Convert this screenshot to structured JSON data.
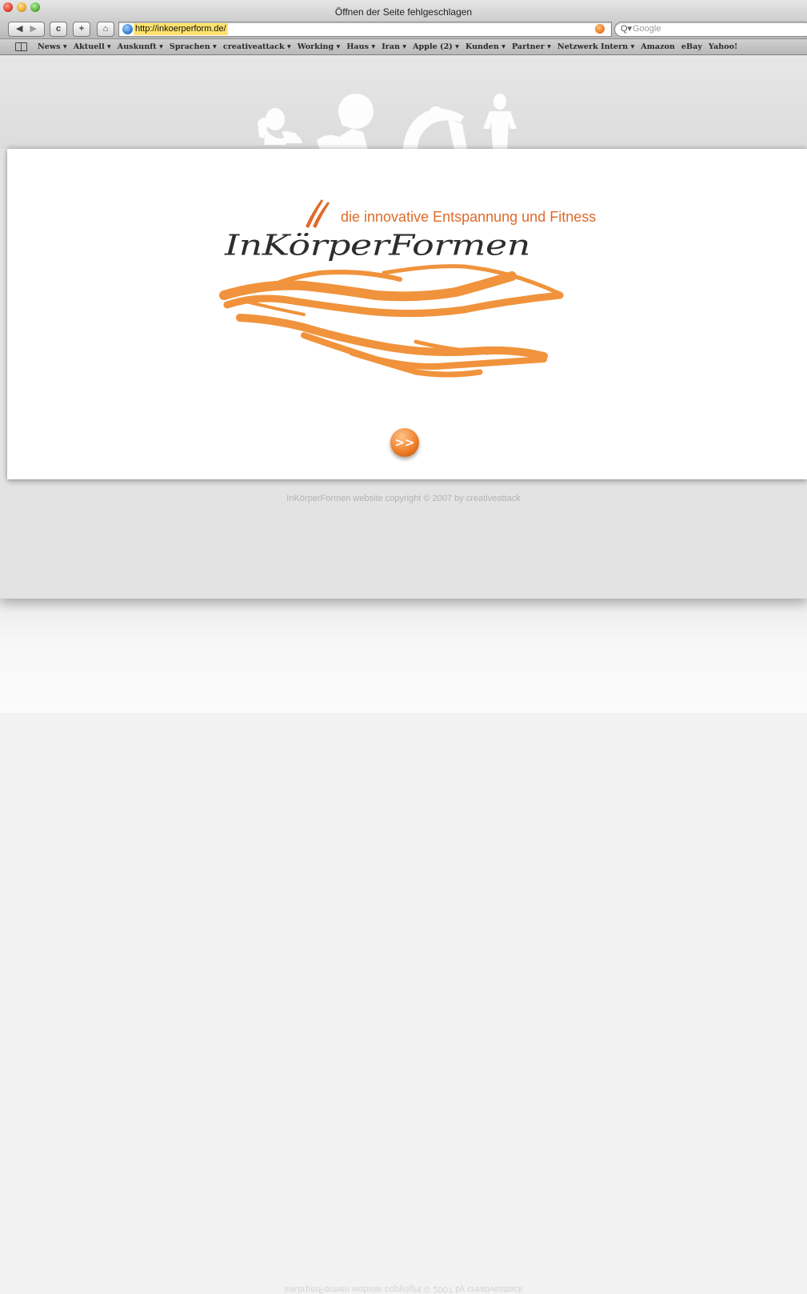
{
  "window": {
    "title": "Öffnen der Seite fehlgeschlagen"
  },
  "toolbar": {
    "back_icon": "back-arrow-icon",
    "forward_icon": "forward-arrow-icon",
    "reload_label": "c",
    "add_label": "+",
    "home_icon": "home-icon",
    "url": "http://inkoerperform.de/",
    "search_placeholder": "Google"
  },
  "bookmarks": [
    "News ▾",
    "Aktuell ▾",
    "Auskunft ▾",
    "Sprachen ▾",
    "creativeattack ▾",
    "Working ▾",
    "Haus ▾",
    "Iran ▾",
    "Apple (2) ▾",
    "Kunden ▾",
    "Partner ▾",
    "Netzwerk Intern ▾",
    "Amazon",
    "eBay",
    "Yahoo!"
  ],
  "page": {
    "tagline": "die innovative Entspannung und Fitness",
    "brand": "InKörperFormen",
    "enter_button": ">>",
    "copyright": "InKörperFormen website copyright © 2007 by creativeattack",
    "accent_color": "#f0822c"
  }
}
